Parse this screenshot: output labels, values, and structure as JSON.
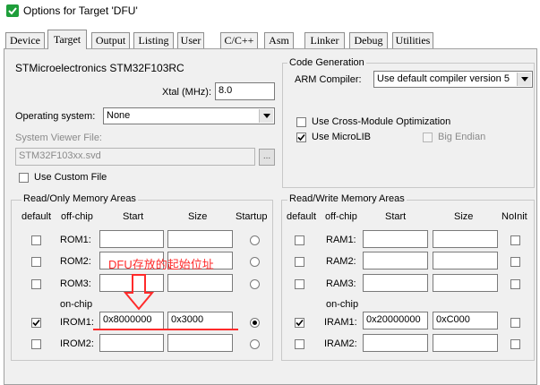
{
  "window": {
    "title": "Options for Target 'DFU'"
  },
  "tabs": [
    {
      "label": "Device"
    },
    {
      "label": "Target"
    },
    {
      "label": "Output"
    },
    {
      "label": "Listing"
    },
    {
      "label": "User"
    },
    {
      "label": "C/C++"
    },
    {
      "label": "Asm"
    },
    {
      "label": "Linker"
    },
    {
      "label": "Debug"
    },
    {
      "label": "Utilities"
    }
  ],
  "active_tab": "Target",
  "device": {
    "name": "STMicroelectronics STM32F103RC",
    "xtal_label": "Xtal (MHz):",
    "xtal_value": "8.0",
    "os_label": "Operating system:",
    "os_value": "None",
    "svd_label": "System Viewer File:",
    "svd_value": "STM32F103xx.svd",
    "svd_browse": "...",
    "custom_file_label": "Use Custom File",
    "custom_file_checked": false
  },
  "code_generation": {
    "title": "Code Generation",
    "compiler_label": "ARM Compiler:",
    "compiler_value": "Use default compiler version 5",
    "cross_module_label": "Use Cross-Module Optimization",
    "cross_module_checked": false,
    "microlib_label": "Use MicroLIB",
    "microlib_checked": true,
    "big_endian_label": "Big Endian",
    "big_endian_checked": false
  },
  "rom_areas": {
    "title": "Read/Only Memory Areas",
    "headers": {
      "default": "default",
      "offchip": "off-chip",
      "start": "Start",
      "size": "Size",
      "startup": "Startup"
    },
    "onchip_label": "on-chip",
    "rows": [
      {
        "name": "ROM1:",
        "start": "",
        "size": "",
        "default": false,
        "startup": false
      },
      {
        "name": "ROM2:",
        "start": "",
        "size": "",
        "default": false,
        "startup": false
      },
      {
        "name": "ROM3:",
        "start": "",
        "size": "",
        "default": false,
        "startup": false
      },
      {
        "name": "IROM1:",
        "start": "0x8000000",
        "size": "0x3000",
        "default": true,
        "startup": true
      },
      {
        "name": "IROM2:",
        "start": "",
        "size": "",
        "default": false,
        "startup": false
      }
    ]
  },
  "ram_areas": {
    "title": "Read/Write Memory Areas",
    "headers": {
      "default": "default",
      "offchip": "off-chip",
      "start": "Start",
      "size": "Size",
      "noinit": "NoInit"
    },
    "onchip_label": "on-chip",
    "rows": [
      {
        "name": "RAM1:",
        "start": "",
        "size": "",
        "default": false,
        "noinit": false
      },
      {
        "name": "RAM2:",
        "start": "",
        "size": "",
        "default": false,
        "noinit": false
      },
      {
        "name": "RAM3:",
        "start": "",
        "size": "",
        "default": false,
        "noinit": false
      },
      {
        "name": "IRAM1:",
        "start": "0x20000000",
        "size": "0xC000",
        "default": true,
        "noinit": false
      },
      {
        "name": "IRAM2:",
        "start": "",
        "size": "",
        "default": false,
        "noinit": false
      }
    ]
  },
  "annotation": {
    "text": "DFU存放的起始位址",
    "color": "#ff2a2a"
  },
  "colors": {
    "dialog_bg": "#f0f0f0",
    "accent_icon": "#1e9e3a"
  }
}
